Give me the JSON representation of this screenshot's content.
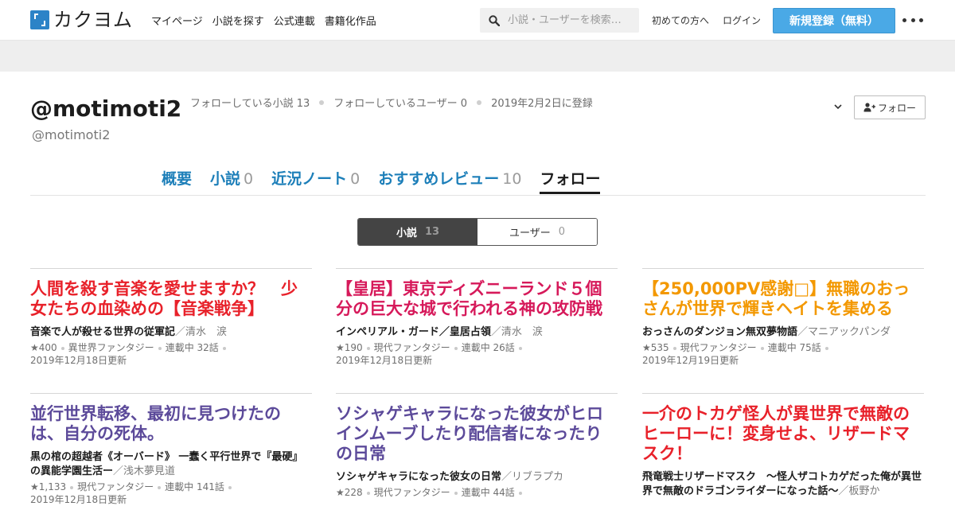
{
  "header": {
    "logo": "カクヨム",
    "nav": [
      "マイページ",
      "小説を探す",
      "公式連載",
      "書籍化作品"
    ],
    "search_placeholder": "小説・ユーザーを検索…",
    "first_time": "初めての方へ",
    "login": "ログイン",
    "register": "新規登録（無料）"
  },
  "profile": {
    "name": "@motimoti2",
    "id": "@motimoti2",
    "stat_novels": "フォローしている小説 13",
    "stat_users": "フォローしているユーザー 0",
    "stat_registered": "2019年2月2日に登録",
    "follow_button": "フォロー"
  },
  "tabs": [
    {
      "label": "概要",
      "count": ""
    },
    {
      "label": "小説",
      "count": "0"
    },
    {
      "label": "近況ノート",
      "count": "0"
    },
    {
      "label": "おすすめレビュー",
      "count": "10"
    },
    {
      "label": "フォロー",
      "count": ""
    }
  ],
  "toggle": {
    "novels_label": "小説",
    "novels_count": "13",
    "users_label": "ユーザー",
    "users_count": "0"
  },
  "colors": {
    "accent_blue": "#1d7fb9",
    "register_button": "#4aa9e6",
    "red_title": "#e8212a",
    "crimson_title": "#d6195a",
    "orange_title": "#f39800",
    "purple_title": "#5c4a9a"
  },
  "cards": [
    {
      "title": "人間を殺す音楽を愛せますか？　少女たちの血染めの【音楽戦争】",
      "color": "#e8212a",
      "catch": "音楽で人が殺せる世界の従軍記",
      "author": "／清水　涙",
      "stars": "★400",
      "genre": "異世界ファンタジー",
      "status": "連載中 32話",
      "updated": "2019年12月18日更新"
    },
    {
      "title": "【皇居】東京ディズニーランド５個分の巨大な城で行われる神の攻防戦",
      "color": "#d6195a",
      "catch": "インペリアル・ガード／皇居占領",
      "author": "／清水　涙",
      "stars": "★190",
      "genre": "現代ファンタジー",
      "status": "連載中 26話",
      "updated": "2019年12月18日更新"
    },
    {
      "title": "【250,000PV感謝□】無職のおっさんが世界で輝きヘイトを集める",
      "color": "#f39800",
      "catch": "おっさんのダンジョン無双夢物語",
      "author": "／マニアックパンダ",
      "stars": "★535",
      "genre": "現代ファンタジー",
      "status": "連載中 75話",
      "updated": "2019年12月19日更新"
    },
    {
      "title": "並行世界転移、最初に見つけたのは、自分の死体。",
      "color": "#5c4a9a",
      "catch": "黒の棺の超越者《オーバード》 一蠢く平行世界で『最硬』の異能学園生活ー",
      "author": "／浅木夢見道",
      "stars": "★1,133",
      "genre": "現代ファンタジー",
      "status": "連載中 141話",
      "updated": "2019年12月18日更新"
    },
    {
      "title": "ソシャゲキャラになった彼女がヒロインムーブしたり配信者になったりの日常",
      "color": "#5c4a9a",
      "catch": "ソシャゲキャラになった彼女の日常",
      "author": "／リブラプカ",
      "stars": "★228",
      "genre": "現代ファンタジー",
      "status": "連載中 44話",
      "updated": ""
    },
    {
      "title": "一介のトカゲ怪人が異世界で無敵のヒーローに！変身せよ、リザードマスク！",
      "color": "#e8212a",
      "catch": "飛竜戦士リザードマスク　～怪人ザコトカゲだった俺が異世界で無敵のドラゴンライダーになった話～",
      "author": "／板野か",
      "stars": "",
      "genre": "",
      "status": "",
      "updated": ""
    }
  ]
}
